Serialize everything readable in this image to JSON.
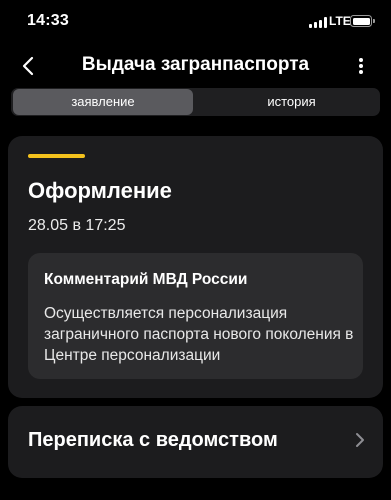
{
  "status_bar": {
    "time": "14:33",
    "network": "LTE"
  },
  "nav": {
    "title": "Выдача загранпаспорта"
  },
  "tabs": [
    {
      "label": "заявление",
      "active": true
    },
    {
      "label": "история",
      "active": false
    }
  ],
  "status_card": {
    "accent_color": "#f4c21d",
    "title": "Оформление",
    "date": "28.05 в 17:25",
    "comment": {
      "title": "Комментарий МВД России",
      "text": "Осуществляется персонализация заграничного паспорта нового поколения в Центре персонализации"
    }
  },
  "correspondence": {
    "label": "Переписка с ведомством"
  },
  "icons": {
    "back": "chevron-left-icon",
    "more": "more-vertical-icon",
    "forward": "chevron-right-icon"
  }
}
